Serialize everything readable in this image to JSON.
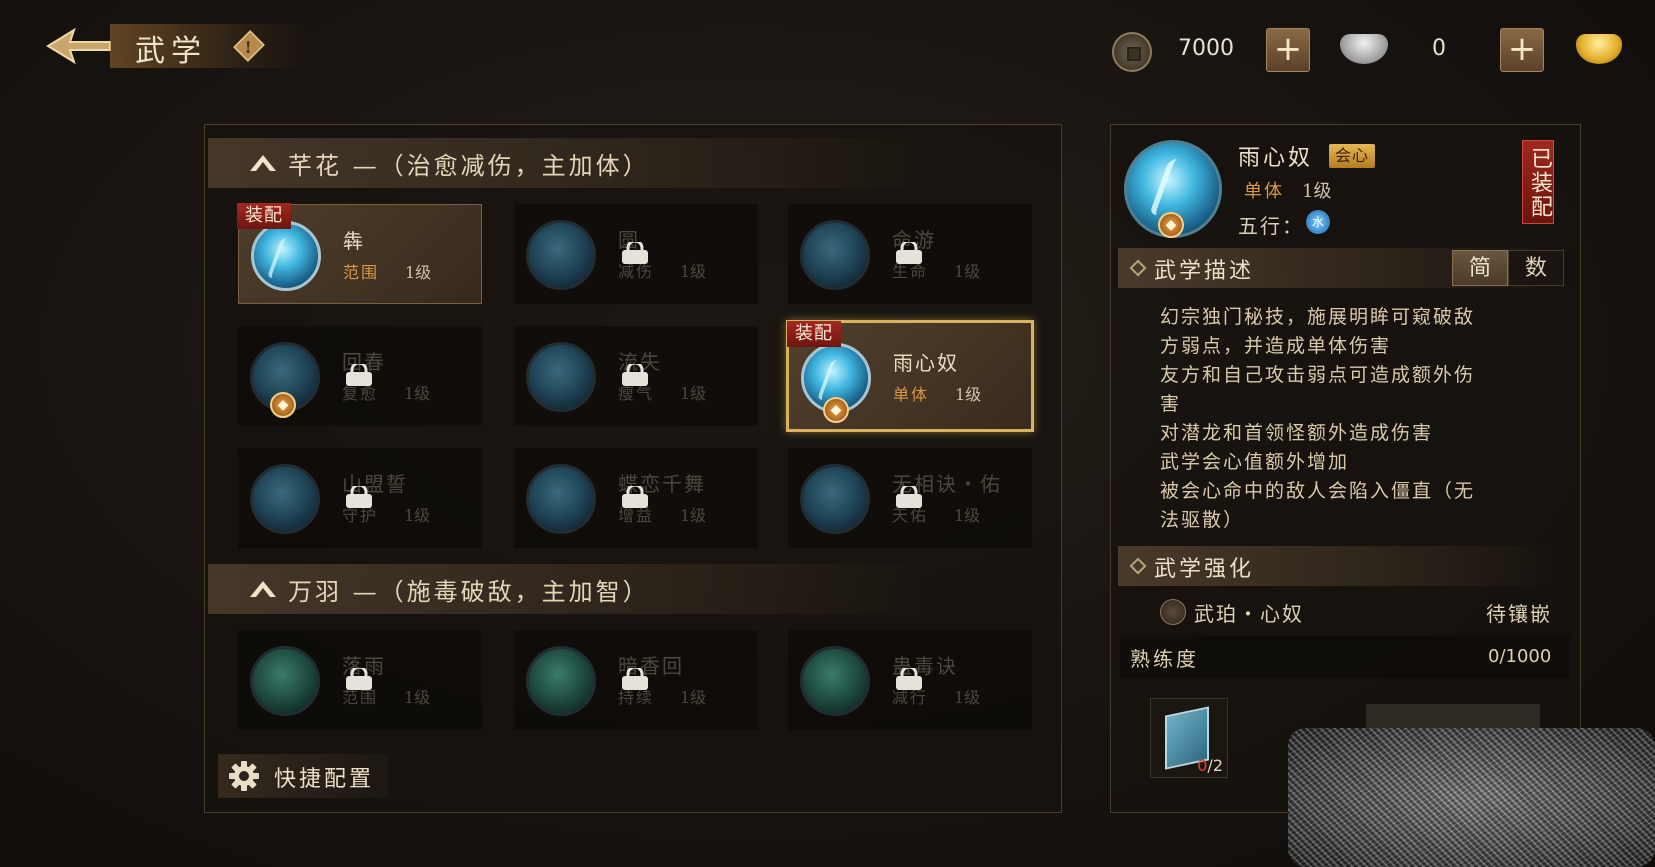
{
  "header": {
    "title": "武学",
    "info_mark": "!",
    "copper_value": "7000",
    "silver_value": "0",
    "plus_label": "+"
  },
  "sections": [
    {
      "title": "芊花 —（治愈减伤，主加体）",
      "skills": [
        {
          "name": "犇",
          "type": "范围",
          "level": "1级",
          "state": "equipped",
          "tag": "装配"
        },
        {
          "name": "圆",
          "type": "减伤",
          "level": "1级",
          "state": "locked"
        },
        {
          "name": "命游",
          "type": "生命",
          "level": "1级",
          "state": "locked"
        },
        {
          "name": "回春",
          "type": "复愈",
          "level": "1级",
          "state": "locked"
        },
        {
          "name": "流失",
          "type": "瘦气",
          "level": "1级",
          "state": "locked"
        },
        {
          "name": "雨心奴",
          "type": "单体",
          "level": "1级",
          "state": "selected",
          "tag": "装配"
        },
        {
          "name": "山盟誓",
          "type": "守护",
          "level": "1级",
          "state": "locked"
        },
        {
          "name": "蝶恋千舞",
          "type": "增益",
          "level": "1级",
          "state": "locked"
        },
        {
          "name": "无相诀・佑",
          "type": "天佑",
          "level": "1级",
          "state": "locked"
        }
      ]
    },
    {
      "title": "万羽 —（施毒破敌，主加智）",
      "skills": [
        {
          "name": "落雨",
          "type": "范围",
          "level": "1级",
          "state": "locked"
        },
        {
          "name": "暗香回",
          "type": "持续",
          "level": "1级",
          "state": "locked"
        },
        {
          "name": "蛊毒诀",
          "type": "减行",
          "level": "1级",
          "state": "locked"
        }
      ]
    }
  ],
  "quick_config_label": "快捷配置",
  "detail": {
    "name": "雨心奴",
    "crit_badge": "会心",
    "type": "单体",
    "level": "1级",
    "wuxing_label": "五行：",
    "wuxing_value": "水",
    "equipped_stamp": "已装配",
    "desc_header": "武学描述",
    "tab_simple": "简",
    "tab_number": "数",
    "description": [
      "幻宗独门秘技，施展明眸可窥破敌",
      "方弱点，并造成单体伤害",
      "友方和自己攻击弱点可造成额外伤",
      "害",
      "对潜龙和首领怪额外造成伤害",
      "武学会心值额外增加",
      "被会心命中的敌人会陷入僵直（无",
      "法驱散）"
    ],
    "enhance_header": "武学强化",
    "enhance_item_name": "武珀・心奴",
    "enhance_item_status": "待镶嵌",
    "proficiency_label": "熟练度",
    "proficiency_value": "0/1000",
    "book_have": "0",
    "book_need": "/2"
  },
  "colors": {
    "accent_gold": "#d8b25c",
    "equip_red": "#a3281f",
    "skill_type_orange": "#d79a4a"
  }
}
